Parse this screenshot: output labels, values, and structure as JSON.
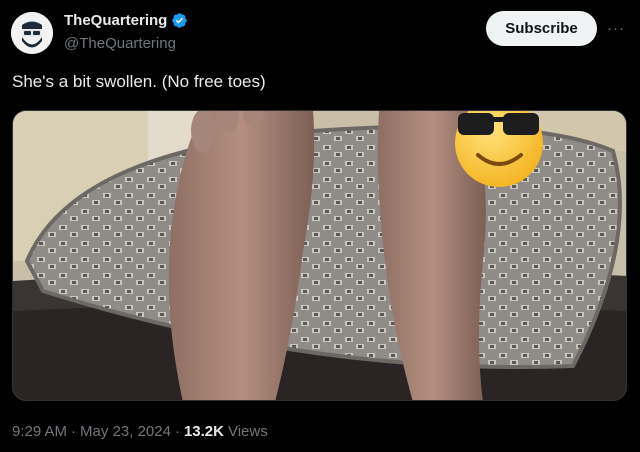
{
  "author": {
    "display_name": "TheQuartering",
    "handle": "@TheQuartering",
    "verified": true
  },
  "header": {
    "subscribe_label": "Subscribe",
    "more_label": "···"
  },
  "tweet": {
    "text": "She's a bit swollen. (No free toes)"
  },
  "media": {
    "overlay_icon": "sunglasses-emoji-icon"
  },
  "footer": {
    "time": "9:29 AM",
    "sep1": "·",
    "date": "May 23, 2024",
    "sep2": "·",
    "views_count": "13.2K",
    "views_label": "Views"
  },
  "colors": {
    "background": "#000000",
    "primary_text": "#e7e9ea",
    "secondary_text": "#71767b",
    "verified_badge": "#1d9bf0",
    "subscribe_bg": "#eff3f4"
  }
}
